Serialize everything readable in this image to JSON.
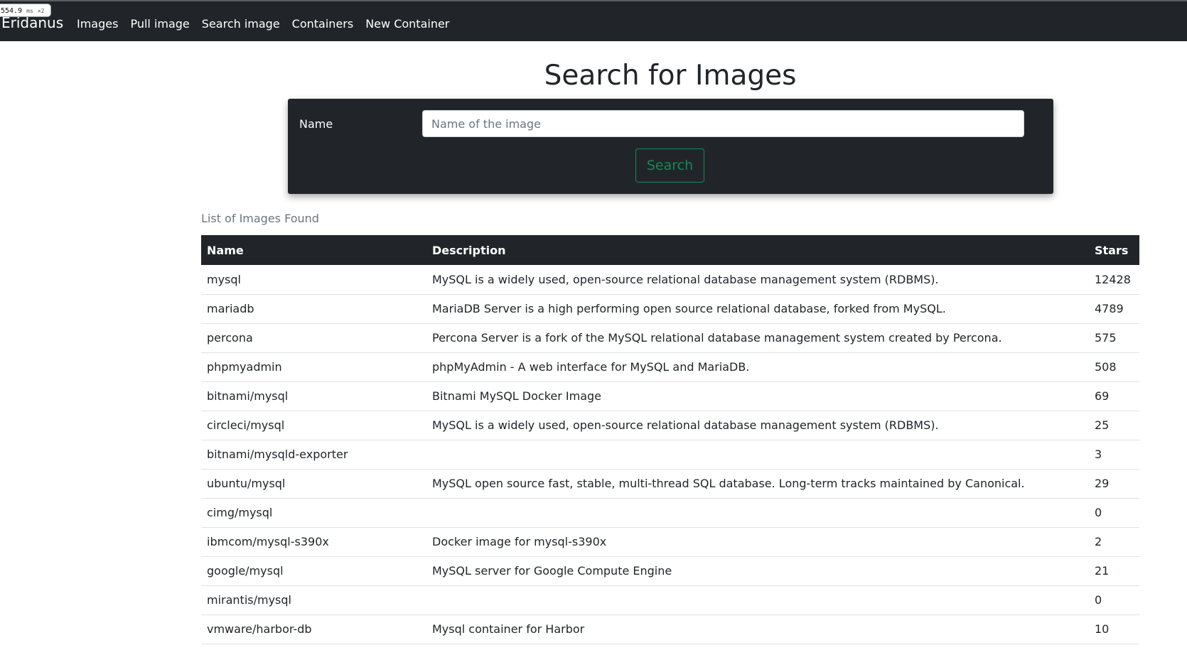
{
  "perf_badge": {
    "value": "554.9",
    "unit": "ms",
    "multiplier": "×2"
  },
  "navbar": {
    "brand": "Eridanus",
    "links": [
      "Images",
      "Pull image",
      "Search image",
      "Containers",
      "New Container"
    ]
  },
  "page": {
    "title": "Search for Images"
  },
  "search_form": {
    "name_label": "Name",
    "name_value": "",
    "name_placeholder": "Name of the image",
    "submit_label": "Search"
  },
  "results": {
    "caption": "List of Images Found",
    "columns": [
      "Name",
      "Description",
      "Stars"
    ],
    "rows": [
      {
        "name": "mysql",
        "description": "MySQL is a widely used, open-source relational database management system (RDBMS).",
        "stars": "12428"
      },
      {
        "name": "mariadb",
        "description": "MariaDB Server is a high performing open source relational database, forked from MySQL.",
        "stars": "4789"
      },
      {
        "name": "percona",
        "description": "Percona Server is a fork of the MySQL relational database management system created by Percona.",
        "stars": "575"
      },
      {
        "name": "phpmyadmin",
        "description": "phpMyAdmin - A web interface for MySQL and MariaDB.",
        "stars": "508"
      },
      {
        "name": "bitnami/mysql",
        "description": "Bitnami MySQL Docker Image",
        "stars": "69"
      },
      {
        "name": "circleci/mysql",
        "description": "MySQL is a widely used, open-source relational database management system (RDBMS).",
        "stars": "25"
      },
      {
        "name": "bitnami/mysqld-exporter",
        "description": "",
        "stars": "3"
      },
      {
        "name": "ubuntu/mysql",
        "description": "MySQL open source fast, stable, multi-thread SQL database. Long-term tracks maintained by Canonical.",
        "stars": "29"
      },
      {
        "name": "cimg/mysql",
        "description": "",
        "stars": "0"
      },
      {
        "name": "ibmcom/mysql-s390x",
        "description": "Docker image for mysql-s390x",
        "stars": "2"
      },
      {
        "name": "google/mysql",
        "description": "MySQL server for Google Compute Engine",
        "stars": "21"
      },
      {
        "name": "mirantis/mysql",
        "description": "",
        "stars": "0"
      },
      {
        "name": "vmware/harbor-db",
        "description": "Mysql container for Harbor",
        "stars": "10"
      }
    ]
  },
  "colors": {
    "navbar_bg": "#212529",
    "accent_success": "#198754",
    "muted_text": "#6c757d"
  }
}
